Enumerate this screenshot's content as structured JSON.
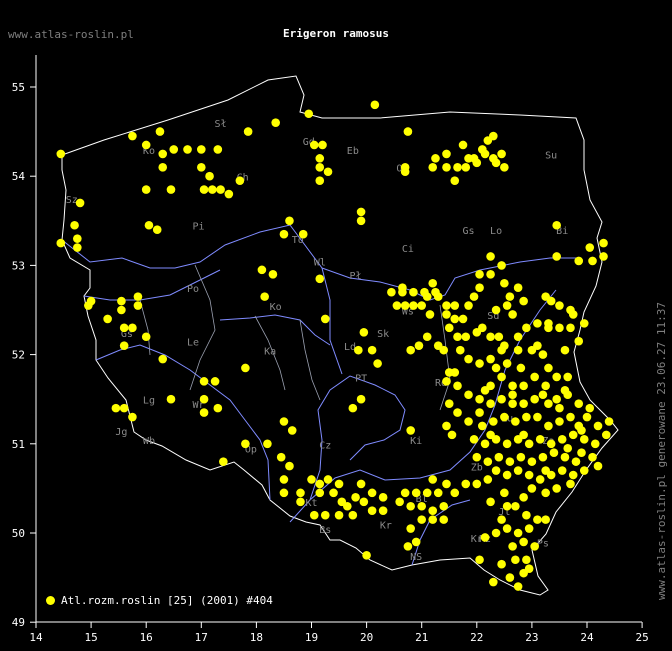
{
  "header": {
    "site": "www.atlas-roslin.pl",
    "title": "Erigeron ramosus"
  },
  "side_note": "www.atlas-roslin.pl generowane 23.06.27 11:37",
  "legend": {
    "label": "Atl.rozm.roslin [25] (2001) #404"
  },
  "colors": {
    "background": "#000000",
    "points": "#ffff00",
    "border": "#ffffff",
    "rivers": "#7f8bff",
    "regions": "#9aa0b0",
    "axis": "#ffffff"
  },
  "axes": {
    "x_ticks": [
      "14",
      "15",
      "16",
      "17",
      "18",
      "19",
      "20",
      "21",
      "22",
      "23",
      "24",
      "25"
    ],
    "y_ticks": [
      "55",
      "54",
      "53",
      "52",
      "51",
      "50",
      "49"
    ]
  },
  "regions": [
    {
      "code": "Sł",
      "lon": 17.35,
      "lat": 54.55
    },
    {
      "code": "Gd",
      "lon": 18.95,
      "lat": 54.35
    },
    {
      "code": "Eb",
      "lon": 19.75,
      "lat": 54.25
    },
    {
      "code": "Su",
      "lon": 23.35,
      "lat": 54.2
    },
    {
      "code": "Ko",
      "lon": 16.05,
      "lat": 54.25
    },
    {
      "code": "Ch",
      "lon": 17.75,
      "lat": 53.95
    },
    {
      "code": "Ol",
      "lon": 20.65,
      "lat": 54.05
    },
    {
      "code": "Sz",
      "lon": 14.65,
      "lat": 53.7
    },
    {
      "code": "Bi",
      "lon": 23.55,
      "lat": 53.35
    },
    {
      "code": "Pi",
      "lon": 16.95,
      "lat": 53.4
    },
    {
      "code": "To",
      "lon": 18.75,
      "lat": 53.25
    },
    {
      "code": "Ci",
      "lon": 20.75,
      "lat": 53.15
    },
    {
      "code": "Gs",
      "lon": 21.85,
      "lat": 53.35
    },
    {
      "code": "Lo",
      "lon": 22.35,
      "lat": 53.35
    },
    {
      "code": "Wl",
      "lon": 19.15,
      "lat": 53.0
    },
    {
      "code": "Pł",
      "lon": 19.8,
      "lat": 52.85
    },
    {
      "code": "Po",
      "lon": 16.85,
      "lat": 52.7
    },
    {
      "code": "Ko",
      "lon": 18.35,
      "lat": 52.5
    },
    {
      "code": "Ws",
      "lon": 20.75,
      "lat": 52.45
    },
    {
      "code": "Sd",
      "lon": 22.3,
      "lat": 52.4
    },
    {
      "code": "Sk",
      "lon": 20.3,
      "lat": 52.2
    },
    {
      "code": "Gs",
      "lon": 15.65,
      "lat": 52.2
    },
    {
      "code": "Le",
      "lon": 16.85,
      "lat": 52.1
    },
    {
      "code": "Ka",
      "lon": 18.25,
      "lat": 52.0
    },
    {
      "code": "Ld",
      "lon": 19.7,
      "lat": 52.05
    },
    {
      "code": "Rd",
      "lon": 21.35,
      "lat": 51.65
    },
    {
      "code": "PT",
      "lon": 19.9,
      "lat": 51.7
    },
    {
      "code": "Lu",
      "lon": 22.55,
      "lat": 51.25
    },
    {
      "code": "Lg",
      "lon": 16.05,
      "lat": 51.45
    },
    {
      "code": "Wr",
      "lon": 16.95,
      "lat": 51.4
    },
    {
      "code": "Jg",
      "lon": 15.55,
      "lat": 51.1
    },
    {
      "code": "Wb",
      "lon": 16.05,
      "lat": 51.0
    },
    {
      "code": "Op",
      "lon": 17.9,
      "lat": 50.9
    },
    {
      "code": "Cz",
      "lon": 19.25,
      "lat": 50.95
    },
    {
      "code": "Ki",
      "lon": 20.9,
      "lat": 51.0
    },
    {
      "code": "Zb",
      "lon": 22.0,
      "lat": 50.7
    },
    {
      "code": "Za",
      "lon": 23.3,
      "lat": 51.0
    },
    {
      "code": "Kt",
      "lon": 19.0,
      "lat": 50.3
    },
    {
      "code": "Bs",
      "lon": 19.25,
      "lat": 50.0
    },
    {
      "code": "Kr",
      "lon": 20.35,
      "lat": 50.05
    },
    {
      "code": "Bl",
      "lon": 21.0,
      "lat": 50.35
    },
    {
      "code": "Jl",
      "lon": 22.5,
      "lat": 50.2
    },
    {
      "code": "Rz",
      "lon": 22.15,
      "lat": 49.9
    },
    {
      "code": "Ps",
      "lon": 23.2,
      "lat": 49.85
    },
    {
      "code": "NS",
      "lon": 20.9,
      "lat": 49.7
    },
    {
      "code": "Kr",
      "lon": 22.0,
      "lat": 49.9
    }
  ],
  "occurrences": [
    [
      14.45,
      54.25
    ],
    [
      15.75,
      54.45
    ],
    [
      16.25,
      54.5
    ],
    [
      17.0,
      54.3
    ],
    [
      17.3,
      54.3
    ],
    [
      17.85,
      54.5
    ],
    [
      18.35,
      54.6
    ],
    [
      18.95,
      54.7
    ],
    [
      20.15,
      54.8
    ],
    [
      20.75,
      54.5
    ],
    [
      16.0,
      54.35
    ],
    [
      16.3,
      54.25
    ],
    [
      16.3,
      54.1
    ],
    [
      16.5,
      54.3
    ],
    [
      16.75,
      54.3
    ],
    [
      17.0,
      54.1
    ],
    [
      17.05,
      53.85
    ],
    [
      17.2,
      53.85
    ],
    [
      17.35,
      53.85
    ],
    [
      17.15,
      54.0
    ],
    [
      17.5,
      53.8
    ],
    [
      17.7,
      53.95
    ],
    [
      16.0,
      53.85
    ],
    [
      16.45,
      53.85
    ],
    [
      14.8,
      53.7
    ],
    [
      19.05,
      54.35
    ],
    [
      19.2,
      54.35
    ],
    [
      19.15,
      54.2
    ],
    [
      19.3,
      54.05
    ],
    [
      19.15,
      53.95
    ],
    [
      19.15,
      54.1
    ],
    [
      20.7,
      54.1
    ],
    [
      20.7,
      54.05
    ],
    [
      21.2,
      54.1
    ],
    [
      21.25,
      54.2
    ],
    [
      21.45,
      54.1
    ],
    [
      21.45,
      54.25
    ],
    [
      21.65,
      54.1
    ],
    [
      21.8,
      54.1
    ],
    [
      21.75,
      54.35
    ],
    [
      21.6,
      53.95
    ],
    [
      21.85,
      54.2
    ],
    [
      21.95,
      54.2
    ],
    [
      22.0,
      54.15
    ],
    [
      22.2,
      54.4
    ],
    [
      22.3,
      54.45
    ],
    [
      22.3,
      54.2
    ],
    [
      22.1,
      54.3
    ],
    [
      22.45,
      54.25
    ],
    [
      22.5,
      54.1
    ],
    [
      22.35,
      54.15
    ],
    [
      22.15,
      54.25
    ],
    [
      14.45,
      53.25
    ],
    [
      14.75,
      53.3
    ],
    [
      14.75,
      53.2
    ],
    [
      14.7,
      53.45
    ],
    [
      16.05,
      53.45
    ],
    [
      16.2,
      53.4
    ],
    [
      18.5,
      53.35
    ],
    [
      18.85,
      53.35
    ],
    [
      18.6,
      53.5
    ],
    [
      19.9,
      53.6
    ],
    [
      19.9,
      53.5
    ],
    [
      23.45,
      53.45
    ],
    [
      24.05,
      53.2
    ],
    [
      24.3,
      53.25
    ],
    [
      24.3,
      53.1
    ],
    [
      24.1,
      53.05
    ],
    [
      23.85,
      53.05
    ],
    [
      23.45,
      53.1
    ],
    [
      22.25,
      53.1
    ],
    [
      22.45,
      53.0
    ],
    [
      15.0,
      52.6
    ],
    [
      15.3,
      52.4
    ],
    [
      15.55,
      52.6
    ],
    [
      15.55,
      52.5
    ],
    [
      15.85,
      52.55
    ],
    [
      15.85,
      52.65
    ],
    [
      15.6,
      52.3
    ],
    [
      15.75,
      52.3
    ],
    [
      16.0,
      52.2
    ],
    [
      15.6,
      52.1
    ],
    [
      16.3,
      51.95
    ],
    [
      14.95,
      52.55
    ],
    [
      17.05,
      51.7
    ],
    [
      17.25,
      51.7
    ],
    [
      17.05,
      51.5
    ],
    [
      16.45,
      51.5
    ],
    [
      17.05,
      51.35
    ],
    [
      17.3,
      51.4
    ],
    [
      15.45,
      51.4
    ],
    [
      15.6,
      51.4
    ],
    [
      15.75,
      51.3
    ],
    [
      17.4,
      50.8
    ],
    [
      17.8,
      51.0
    ],
    [
      18.2,
      51.0
    ],
    [
      17.8,
      51.85
    ],
    [
      18.1,
      52.95
    ],
    [
      18.3,
      52.9
    ],
    [
      18.15,
      52.65
    ],
    [
      19.15,
      52.85
    ],
    [
      19.25,
      52.4
    ],
    [
      19.75,
      51.4
    ],
    [
      19.9,
      51.5
    ],
    [
      19.85,
      52.05
    ],
    [
      19.95,
      52.25
    ],
    [
      20.1,
      52.05
    ],
    [
      20.2,
      51.9
    ],
    [
      20.8,
      52.05
    ],
    [
      20.65,
      52.75
    ],
    [
      20.8,
      51.15
    ],
    [
      20.45,
      52.7
    ],
    [
      20.65,
      52.7
    ],
    [
      20.85,
      52.7
    ],
    [
      21.05,
      52.7
    ],
    [
      21.25,
      52.7
    ],
    [
      20.55,
      52.55
    ],
    [
      20.7,
      52.55
    ],
    [
      20.85,
      52.55
    ],
    [
      21.0,
      52.55
    ],
    [
      21.2,
      52.8
    ],
    [
      21.1,
      52.65
    ],
    [
      21.3,
      52.65
    ],
    [
      21.45,
      52.55
    ],
    [
      21.45,
      52.45
    ],
    [
      21.6,
      52.55
    ],
    [
      21.6,
      52.4
    ],
    [
      21.75,
      52.4
    ],
    [
      21.85,
      52.55
    ],
    [
      21.95,
      52.65
    ],
    [
      22.05,
      52.75
    ],
    [
      22.05,
      52.9
    ],
    [
      22.25,
      52.9
    ],
    [
      22.5,
      52.8
    ],
    [
      22.6,
      52.65
    ],
    [
      22.75,
      52.75
    ],
    [
      22.85,
      52.6
    ],
    [
      23.25,
      52.65
    ],
    [
      23.35,
      52.6
    ],
    [
      23.5,
      52.55
    ],
    [
      23.75,
      52.45
    ],
    [
      23.95,
      52.35
    ],
    [
      21.5,
      52.3
    ],
    [
      21.65,
      52.2
    ],
    [
      21.8,
      52.2
    ],
    [
      21.7,
      52.05
    ],
    [
      21.3,
      52.1
    ],
    [
      21.1,
      52.2
    ],
    [
      20.95,
      52.1
    ],
    [
      22.0,
      52.25
    ],
    [
      22.1,
      52.3
    ],
    [
      22.25,
      52.2
    ],
    [
      22.4,
      52.2
    ],
    [
      22.5,
      52.1
    ],
    [
      22.75,
      52.2
    ],
    [
      22.9,
      52.3
    ],
    [
      23.1,
      52.35
    ],
    [
      23.3,
      52.35
    ],
    [
      23.5,
      52.3
    ],
    [
      23.7,
      52.3
    ],
    [
      23.85,
      52.15
    ],
    [
      23.6,
      52.05
    ],
    [
      23.2,
      52.0
    ],
    [
      23.0,
      52.05
    ],
    [
      22.75,
      52.05
    ],
    [
      22.45,
      52.05
    ],
    [
      22.25,
      51.95
    ],
    [
      22.05,
      51.9
    ],
    [
      21.85,
      51.95
    ],
    [
      21.6,
      51.8
    ],
    [
      21.45,
      51.7
    ],
    [
      21.65,
      51.65
    ],
    [
      21.85,
      51.55
    ],
    [
      22.05,
      51.5
    ],
    [
      22.25,
      51.65
    ],
    [
      22.45,
      51.75
    ],
    [
      22.65,
      51.65
    ],
    [
      22.85,
      51.65
    ],
    [
      23.05,
      51.75
    ],
    [
      23.25,
      51.65
    ],
    [
      23.45,
      51.75
    ],
    [
      23.6,
      51.6
    ],
    [
      23.45,
      51.5
    ],
    [
      23.3,
      51.45
    ],
    [
      23.05,
      51.5
    ],
    [
      22.85,
      51.45
    ],
    [
      22.65,
      51.45
    ],
    [
      22.45,
      51.5
    ],
    [
      22.25,
      51.45
    ],
    [
      22.05,
      51.35
    ],
    [
      21.85,
      51.25
    ],
    [
      21.65,
      51.35
    ],
    [
      21.45,
      51.2
    ],
    [
      21.5,
      51.45
    ],
    [
      22.1,
      51.2
    ],
    [
      22.3,
      51.25
    ],
    [
      22.5,
      51.3
    ],
    [
      22.7,
      51.25
    ],
    [
      22.9,
      51.3
    ],
    [
      23.1,
      51.3
    ],
    [
      23.3,
      51.2
    ],
    [
      23.5,
      51.25
    ],
    [
      23.7,
      51.3
    ],
    [
      23.85,
      51.2
    ],
    [
      24.0,
      51.3
    ],
    [
      24.2,
      51.2
    ],
    [
      24.15,
      51.0
    ],
    [
      23.95,
      51.05
    ],
    [
      23.75,
      51.1
    ],
    [
      23.55,
      51.05
    ],
    [
      23.35,
      51.0
    ],
    [
      23.15,
      51.05
    ],
    [
      22.95,
      51.0
    ],
    [
      22.75,
      51.05
    ],
    [
      22.55,
      51.0
    ],
    [
      22.35,
      51.05
    ],
    [
      22.15,
      51.0
    ],
    [
      21.95,
      51.05
    ],
    [
      22.0,
      50.85
    ],
    [
      22.2,
      50.8
    ],
    [
      22.4,
      50.85
    ],
    [
      22.6,
      50.8
    ],
    [
      22.8,
      50.85
    ],
    [
      23.0,
      50.8
    ],
    [
      23.2,
      50.85
    ],
    [
      23.4,
      50.9
    ],
    [
      23.6,
      50.85
    ],
    [
      23.8,
      50.8
    ],
    [
      23.95,
      50.7
    ],
    [
      23.75,
      50.65
    ],
    [
      23.55,
      50.7
    ],
    [
      23.35,
      50.65
    ],
    [
      23.15,
      50.6
    ],
    [
      22.95,
      50.65
    ],
    [
      22.75,
      50.7
    ],
    [
      22.55,
      50.65
    ],
    [
      22.35,
      50.7
    ],
    [
      22.2,
      50.6
    ],
    [
      22.0,
      50.55
    ],
    [
      24.1,
      50.85
    ],
    [
      24.2,
      50.75
    ],
    [
      23.0,
      50.5
    ],
    [
      23.25,
      50.45
    ],
    [
      23.45,
      50.5
    ],
    [
      23.7,
      50.55
    ],
    [
      22.85,
      50.4
    ],
    [
      22.7,
      50.3
    ],
    [
      22.5,
      50.45
    ],
    [
      22.25,
      50.35
    ],
    [
      22.55,
      50.3
    ],
    [
      18.5,
      51.25
    ],
    [
      18.65,
      51.15
    ],
    [
      18.45,
      50.85
    ],
    [
      18.6,
      50.75
    ],
    [
      18.5,
      50.6
    ],
    [
      18.5,
      50.45
    ],
    [
      18.8,
      50.45
    ],
    [
      18.8,
      50.35
    ],
    [
      19.0,
      50.6
    ],
    [
      19.15,
      50.55
    ],
    [
      19.3,
      50.6
    ],
    [
      19.5,
      50.55
    ],
    [
      19.4,
      50.45
    ],
    [
      19.55,
      50.35
    ],
    [
      19.65,
      50.3
    ],
    [
      19.8,
      50.4
    ],
    [
      19.75,
      50.2
    ],
    [
      19.95,
      50.35
    ],
    [
      20.1,
      50.25
    ],
    [
      20.3,
      50.25
    ],
    [
      20.3,
      50.4
    ],
    [
      20.1,
      50.45
    ],
    [
      19.9,
      50.55
    ],
    [
      19.15,
      50.45
    ],
    [
      19.05,
      50.2
    ],
    [
      19.25,
      50.2
    ],
    [
      19.5,
      50.2
    ],
    [
      20.6,
      50.35
    ],
    [
      20.8,
      50.3
    ],
    [
      21.0,
      50.3
    ],
    [
      21.2,
      50.25
    ],
    [
      21.4,
      50.3
    ],
    [
      20.7,
      50.45
    ],
    [
      20.9,
      50.45
    ],
    [
      21.1,
      50.45
    ],
    [
      21.3,
      50.45
    ],
    [
      21.2,
      50.6
    ],
    [
      21.45,
      50.55
    ],
    [
      21.6,
      50.45
    ],
    [
      21.8,
      50.55
    ],
    [
      21.0,
      50.15
    ],
    [
      21.2,
      50.15
    ],
    [
      21.4,
      50.15
    ],
    [
      20.8,
      50.05
    ],
    [
      20.9,
      49.9
    ],
    [
      20.75,
      49.85
    ],
    [
      20.0,
      49.75
    ],
    [
      22.15,
      49.95
    ],
    [
      22.35,
      50.0
    ],
    [
      22.55,
      50.05
    ],
    [
      22.75,
      50.0
    ],
    [
      22.95,
      50.05
    ],
    [
      22.65,
      49.85
    ],
    [
      22.85,
      49.9
    ],
    [
      23.05,
      49.85
    ],
    [
      22.7,
      49.7
    ],
    [
      22.9,
      49.7
    ],
    [
      22.85,
      49.55
    ],
    [
      22.6,
      49.5
    ],
    [
      22.45,
      49.65
    ],
    [
      22.05,
      49.7
    ],
    [
      22.3,
      49.45
    ],
    [
      22.75,
      49.4
    ],
    [
      22.95,
      49.6
    ],
    [
      23.1,
      50.15
    ],
    [
      23.25,
      50.15
    ],
    [
      22.9,
      50.2
    ],
    [
      21.5,
      51.8
    ],
    [
      21.4,
      52.05
    ],
    [
      21.15,
      52.45
    ],
    [
      22.35,
      52.5
    ],
    [
      22.55,
      52.55
    ],
    [
      22.65,
      52.45
    ],
    [
      23.65,
      51.55
    ],
    [
      23.85,
      51.45
    ],
    [
      24.05,
      51.4
    ],
    [
      23.9,
      51.15
    ],
    [
      24.4,
      51.25
    ],
    [
      24.35,
      51.1
    ],
    [
      23.65,
      50.95
    ],
    [
      23.25,
      50.7
    ],
    [
      22.45,
      50.15
    ],
    [
      21.55,
      51.1
    ],
    [
      22.25,
      51.1
    ],
    [
      22.85,
      51.1
    ],
    [
      23.5,
      51.4
    ],
    [
      23.2,
      51.55
    ],
    [
      22.65,
      51.55
    ],
    [
      22.15,
      51.6
    ],
    [
      23.7,
      52.5
    ],
    [
      23.3,
      52.3
    ],
    [
      23.1,
      52.1
    ],
    [
      23.3,
      51.85
    ],
    [
      22.8,
      51.85
    ],
    [
      22.55,
      51.9
    ],
    [
      22.35,
      51.85
    ],
    [
      23.9,
      50.9
    ],
    [
      23.65,
      51.75
    ]
  ]
}
